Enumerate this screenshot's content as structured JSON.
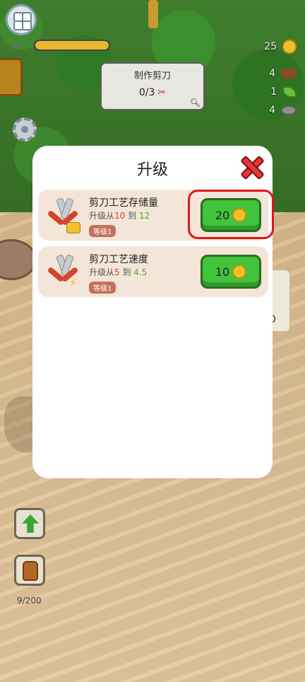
{
  "hud": {
    "xp_progress": 1.0,
    "task": {
      "title": "制作剪刀",
      "progress": "0/3"
    },
    "resources": [
      {
        "name": "coins",
        "icon": "coin-icon",
        "value": "25"
      },
      {
        "name": "wood",
        "icon": "wood-log-icon",
        "value": "4"
      },
      {
        "name": "leaf",
        "icon": "leaf-icon",
        "value": "1"
      },
      {
        "name": "stone",
        "icon": "stone-icon",
        "value": "4"
      }
    ],
    "bag_capacity": "9/200"
  },
  "modal": {
    "title": "升级",
    "upgrades": [
      {
        "name": "剪刀工艺存储量",
        "desc_prefix": "升级从",
        "from": "10",
        "mid": " 到 ",
        "to": "12",
        "level": "等级1",
        "price": "20"
      },
      {
        "name": "剪刀工艺速度",
        "desc_prefix": "升级从",
        "from": "5",
        "mid": " 到 ",
        "to": "4.5",
        "level": "等级1",
        "price": "10"
      }
    ]
  },
  "background": {
    "right_card_text": "0"
  },
  "colors": {
    "highlight": "#e01616",
    "buy_button": "#43c23b",
    "close": "#e53935"
  }
}
